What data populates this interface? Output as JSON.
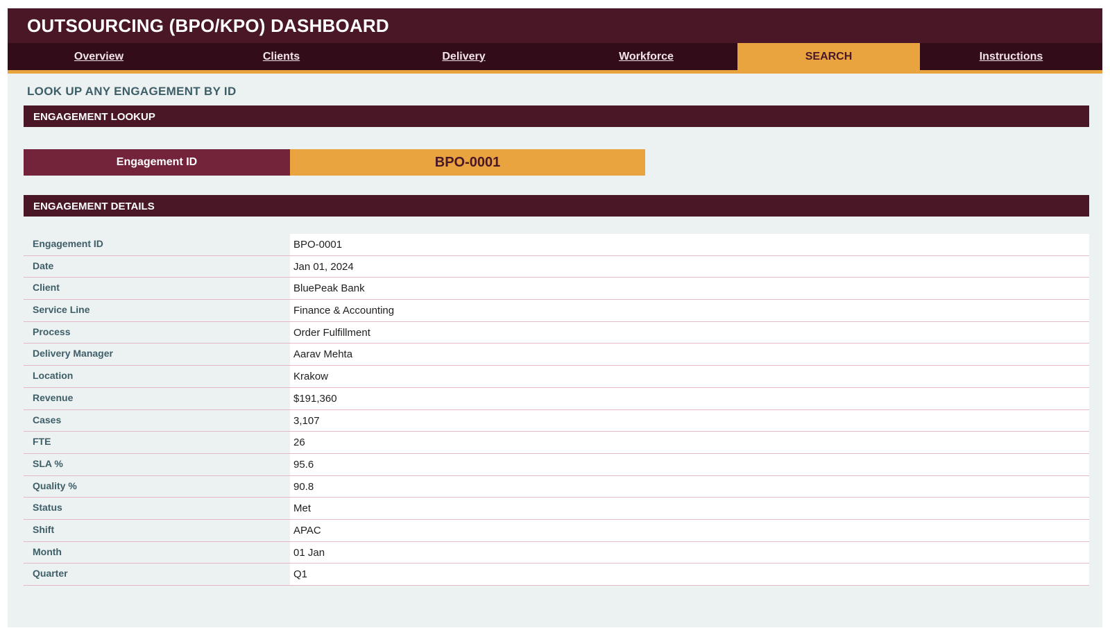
{
  "header": {
    "title": "OUTSOURCING (BPO/KPO) DASHBOARD"
  },
  "tabs": [
    {
      "label": "Overview"
    },
    {
      "label": "Clients"
    },
    {
      "label": "Delivery"
    },
    {
      "label": "Workforce"
    },
    {
      "label": "SEARCH"
    },
    {
      "label": "Instructions"
    }
  ],
  "page": {
    "heading": "LOOK UP ANY ENGAGEMENT BY ID"
  },
  "lookup": {
    "section_title": "ENGAGEMENT LOOKUP",
    "field_label": "Engagement ID",
    "field_value": "BPO-0001"
  },
  "details": {
    "section_title": "ENGAGEMENT DETAILS",
    "rows": [
      {
        "label": "Engagement ID",
        "value": "BPO-0001"
      },
      {
        "label": "Date",
        "value": "Jan 01, 2024"
      },
      {
        "label": "Client",
        "value": "BluePeak Bank"
      },
      {
        "label": "Service Line",
        "value": "Finance & Accounting"
      },
      {
        "label": "Process",
        "value": "Order Fulfillment"
      },
      {
        "label": "Delivery Manager",
        "value": "Aarav Mehta"
      },
      {
        "label": "Location",
        "value": "Krakow"
      },
      {
        "label": "Revenue",
        "value": "$191,360"
      },
      {
        "label": "Cases",
        "value": "3,107"
      },
      {
        "label": "FTE",
        "value": "26"
      },
      {
        "label": "SLA %",
        "value": "95.6"
      },
      {
        "label": "Quality %",
        "value": "90.8"
      },
      {
        "label": "Status",
        "value": "Met"
      },
      {
        "label": "Shift",
        "value": "APAC"
      },
      {
        "label": "Month",
        "value": "01 Jan"
      },
      {
        "label": "Quarter",
        "value": "Q1"
      }
    ]
  },
  "colors": {
    "header_bg": "#4a1727",
    "tab_bar_bg": "#320d19",
    "accent": "#e9a43f",
    "label_bg": "#73233a",
    "page_bg": "#ecf1f1"
  }
}
